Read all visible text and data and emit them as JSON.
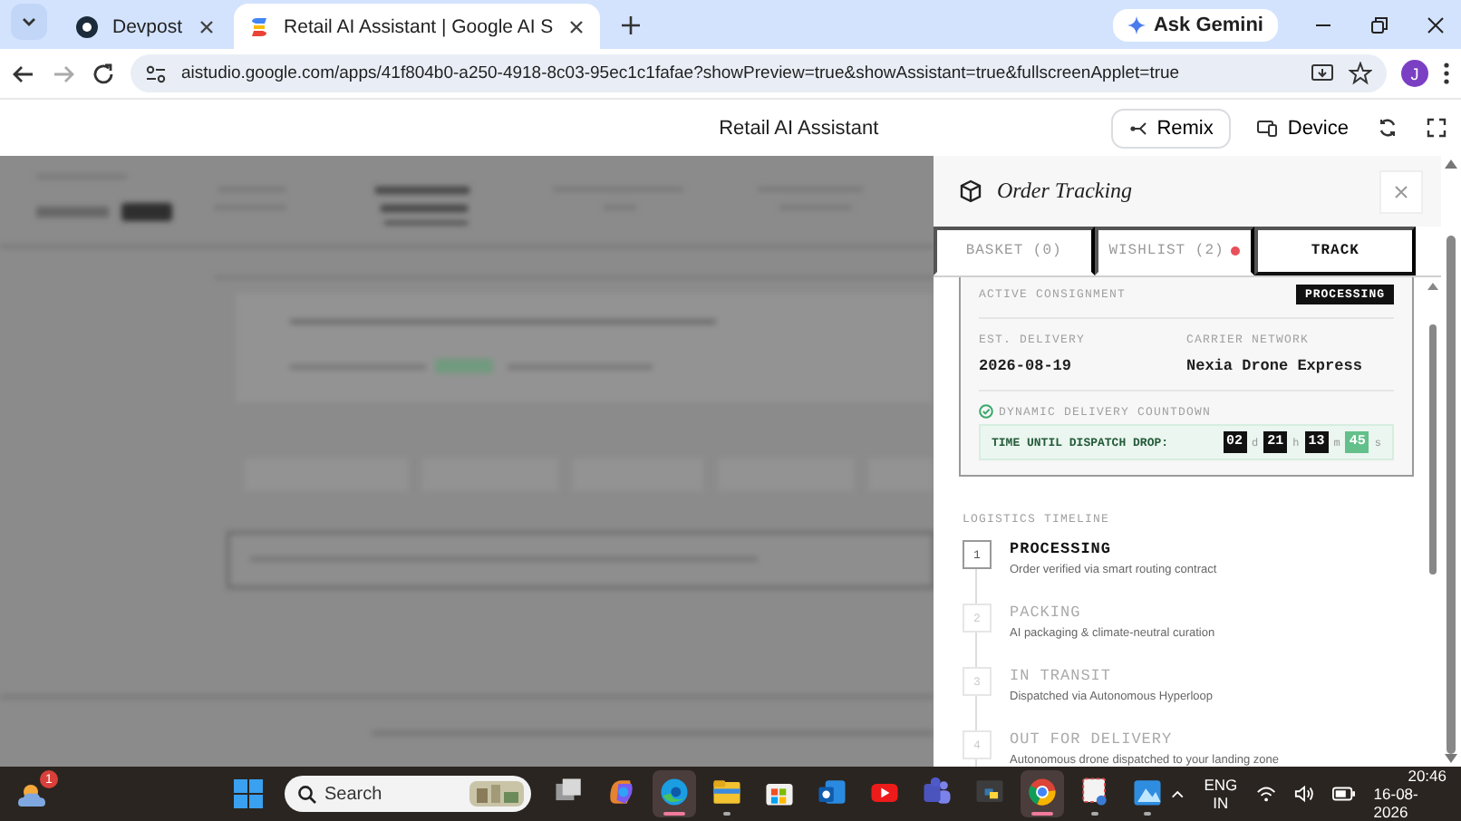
{
  "browser": {
    "tabs": [
      {
        "title": "Devpost",
        "selected": false
      },
      {
        "title": "Retail AI Assistant | Google AI S",
        "selected": true
      }
    ],
    "ask_gemini": "Ask Gemini",
    "url": "aistudio.google.com/apps/41f804b0-a250-4918-8c03-95ec1c1fafae?showPreview=true&showAssistant=true&fullscreenApplet=true",
    "profile": "J"
  },
  "app_header": {
    "title": "Retail AI Assistant",
    "remix": "Remix",
    "device": "Device"
  },
  "panel": {
    "title": "Order Tracking",
    "tabs": [
      {
        "label": "BASKET (0)",
        "selected": false,
        "badge": false
      },
      {
        "label": "WISHLIST (2)",
        "selected": false,
        "badge": true
      },
      {
        "label": "TRACK",
        "selected": true,
        "badge": false
      }
    ],
    "consignment": {
      "label": "ACTIVE CONSIGNMENT",
      "status": "PROCESSING",
      "fields": [
        {
          "label": "EST. DELIVERY",
          "value": "2026-08-19"
        },
        {
          "label": "CARRIER NETWORK",
          "value": "Nexia Drone Express"
        }
      ],
      "countdown": {
        "title": "DYNAMIC DELIVERY COUNTDOWN",
        "label": "TIME UNTIL DISPATCH DROP:",
        "units": [
          {
            "value": "02",
            "unit": "d",
            "highlight": false
          },
          {
            "value": "21",
            "unit": "h",
            "highlight": false
          },
          {
            "value": "13",
            "unit": "m",
            "highlight": false
          },
          {
            "value": "45",
            "unit": "s",
            "highlight": true
          }
        ]
      }
    },
    "timeline": {
      "title": "LOGISTICS TIMELINE",
      "steps": [
        {
          "number": "1",
          "title": "PROCESSING",
          "description": "Order verified via smart routing contract",
          "active": true
        },
        {
          "number": "2",
          "title": "PACKING",
          "description": "AI packaging & climate-neutral curation",
          "active": false
        },
        {
          "number": "3",
          "title": "IN TRANSIT",
          "description": "Dispatched via Autonomous Hyperloop",
          "active": false
        },
        {
          "number": "4",
          "title": "OUT FOR DELIVERY",
          "description": "Autonomous drone dispatched to your landing zone",
          "active": false
        }
      ]
    }
  },
  "taskbar": {
    "notification_count": "1",
    "search_placeholder": "Search",
    "apps": [
      {
        "kind": "taskview",
        "running": false,
        "selected": false
      },
      {
        "kind": "copilot",
        "running": false,
        "selected": false
      },
      {
        "kind": "edge",
        "running": true,
        "selected": true
      },
      {
        "kind": "explorer",
        "running": true,
        "selected": false
      },
      {
        "kind": "store",
        "running": false,
        "selected": false
      },
      {
        "kind": "outlook",
        "running": false,
        "selected": false
      },
      {
        "kind": "youtube",
        "running": false,
        "selected": false
      },
      {
        "kind": "teams",
        "running": false,
        "selected": false
      },
      {
        "kind": "python",
        "running": false,
        "selected": false
      },
      {
        "kind": "chrome",
        "running": true,
        "selected": true
      },
      {
        "kind": "snipping",
        "running": true,
        "selected": false
      },
      {
        "kind": "photos",
        "running": true,
        "selected": false
      }
    ],
    "language": "ENG",
    "region": "IN",
    "time": "20:46",
    "date": "16-08-2026"
  }
}
